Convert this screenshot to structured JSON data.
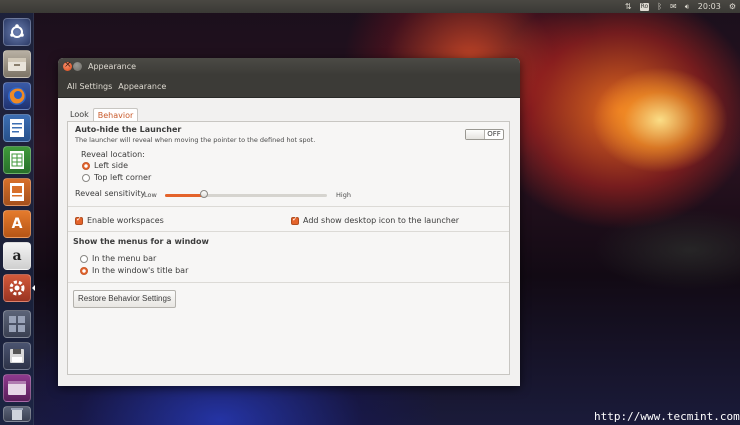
{
  "top_panel": {
    "keyboard_layout": "Ro",
    "time": "20:03",
    "icons": [
      "network-icon",
      "keyboard-icon",
      "bluetooth-icon",
      "mail-icon",
      "volume-icon",
      "gear-icon"
    ]
  },
  "launcher": {
    "items": [
      "ubuntu-dash-icon",
      "files-icon",
      "firefox-icon",
      "writer-icon",
      "calc-icon",
      "impress-icon",
      "software-center-icon",
      "amazon-icon",
      "system-settings-icon",
      "workspaces-icon",
      "disk-icon",
      "app-icon",
      "trash-icon"
    ],
    "amazon_glyph": "a",
    "software_glyph": "A"
  },
  "window": {
    "title": "Appearance",
    "toolbar": {
      "all_settings": "All Settings",
      "current": "Appearance"
    },
    "tabs": [
      {
        "label": "Look",
        "active": false
      },
      {
        "label": "Behavior",
        "active": true
      }
    ],
    "autohide": {
      "title": "Auto-hide the Launcher",
      "description": "The launcher will reveal when moving the pointer to the defined hot spot.",
      "state": "OFF",
      "reveal_location_label": "Reveal location:",
      "options": [
        "Left side",
        "Top left corner"
      ],
      "selected": "Left side",
      "sensitivity_label": "Reveal sensitivity",
      "low_label": "Low",
      "high_label": "High",
      "sensitivity_value": 0.24
    },
    "enable_workspaces": {
      "label": "Enable workspaces",
      "checked": true
    },
    "show_desktop_icon": {
      "label": "Add show desktop icon to the launcher",
      "checked": true
    },
    "menus": {
      "title": "Show the menus for a window",
      "options": [
        "In the menu bar",
        "In the window's title bar"
      ],
      "selected": "In the window's title bar"
    },
    "restore_button": "Restore Behavior Settings"
  },
  "watermark": "http://www.tecmint.com",
  "colors": {
    "accent": "#e4632b",
    "panel_dark": "#3c3b37"
  }
}
